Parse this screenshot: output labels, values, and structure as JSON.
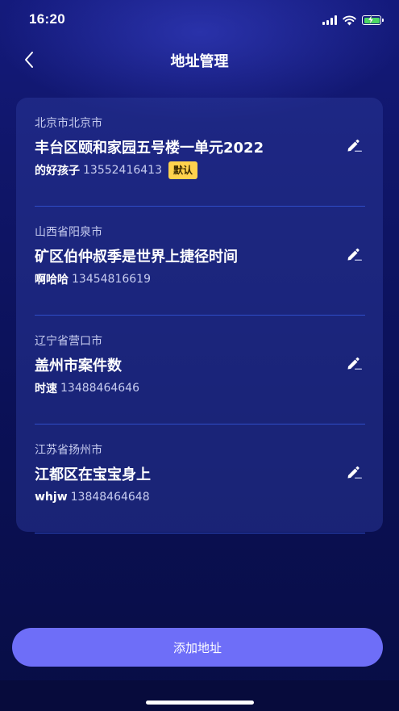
{
  "status_bar": {
    "time": "16:20",
    "icons": [
      "cellular-signal-icon",
      "wifi-icon",
      "battery-charging-icon"
    ],
    "battery_color": "#4cd964"
  },
  "nav": {
    "title": "地址管理",
    "back_icon": "chevron-left-icon"
  },
  "addresses": [
    {
      "region": "北京市北京市",
      "street": "丰台区颐和家园五号楼一单元2022",
      "name": "的好孩子",
      "phone": "13552416413",
      "badge": "默认",
      "edit_icon": "edit-pencil-icon"
    },
    {
      "region": "山西省阳泉市",
      "street": "矿区伯仲叔季是世界上捷径时间",
      "name": "啊哈哈",
      "phone": "13454816619",
      "edit_icon": "edit-pencil-icon"
    },
    {
      "region": "辽宁省营口市",
      "street": "盖州市案件数",
      "name": "时速",
      "phone": "13488464646",
      "edit_icon": "edit-pencil-icon"
    },
    {
      "region": "江苏省扬州市",
      "street": "江都区在宝宝身上",
      "name": "whjw",
      "phone": "13848464648",
      "edit_icon": "edit-pencil-icon"
    }
  ],
  "add_button": {
    "label": "添加地址"
  },
  "colors": {
    "accent": "#6e6ef8",
    "badge": "#ffd24d",
    "background": "#0b1158",
    "card": "#283496"
  }
}
